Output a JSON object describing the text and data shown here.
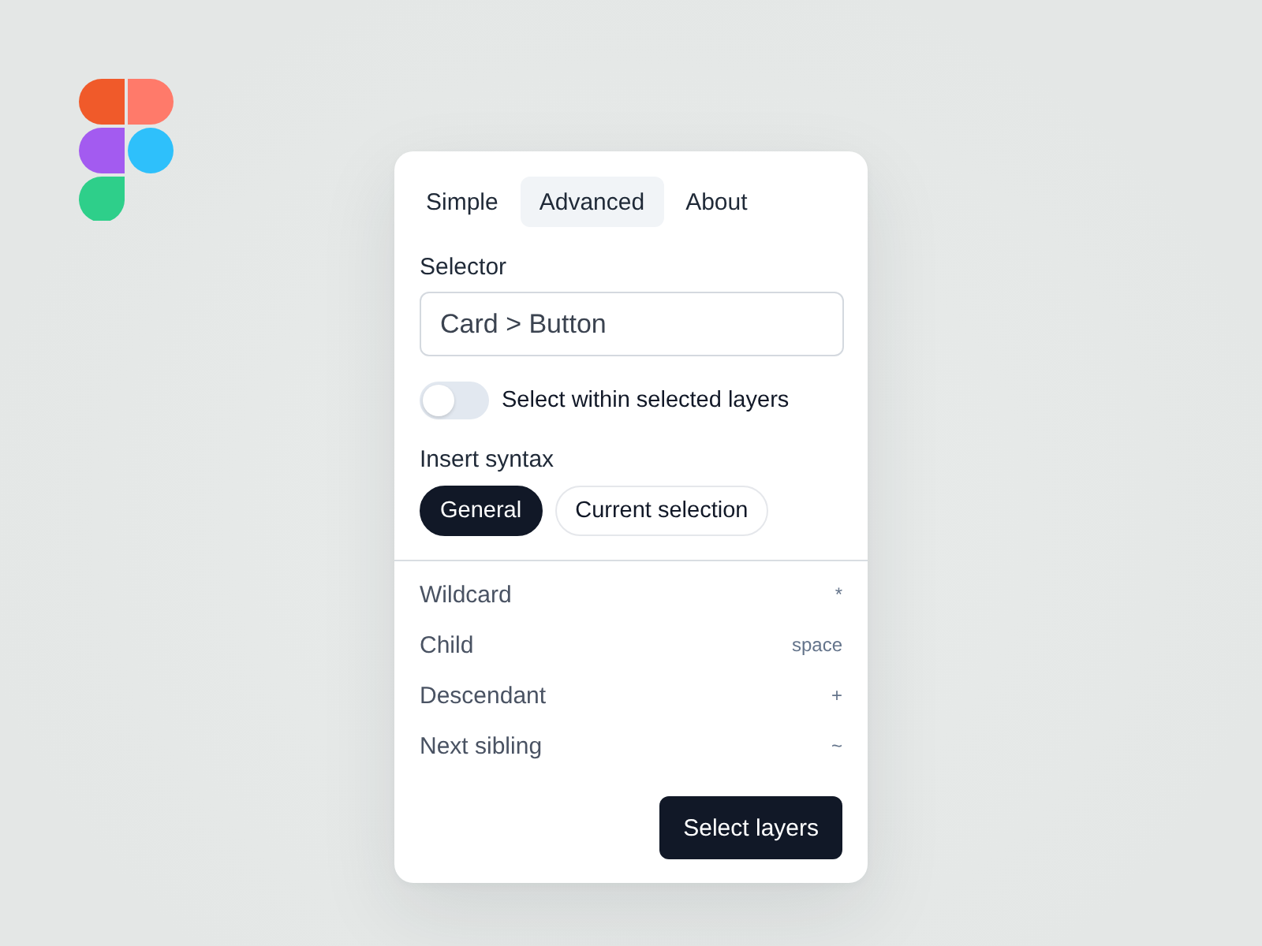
{
  "tabs": [
    {
      "label": "Simple",
      "selected": false
    },
    {
      "label": "Advanced",
      "selected": true
    },
    {
      "label": "About",
      "selected": false
    }
  ],
  "selector": {
    "label": "Selector",
    "value": "Card > Button"
  },
  "toggle": {
    "label": "Select within selected layers",
    "on": false
  },
  "insert_syntax": {
    "label": "Insert syntax",
    "modes": [
      {
        "label": "General",
        "selected": true
      },
      {
        "label": "Current selection",
        "selected": false
      }
    ],
    "items": [
      {
        "name": "Wildcard",
        "shortcut": "*"
      },
      {
        "name": "Child",
        "shortcut": "space"
      },
      {
        "name": "Descendant",
        "shortcut": "+"
      },
      {
        "name": "Next sibling",
        "shortcut": "~"
      }
    ]
  },
  "primary_button": {
    "label": "Select layers"
  }
}
